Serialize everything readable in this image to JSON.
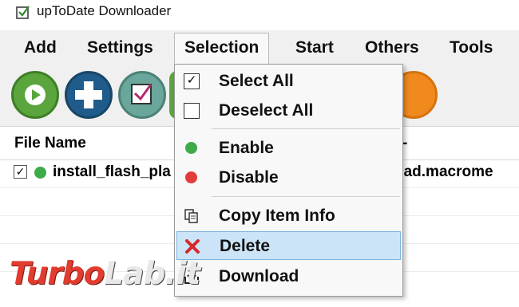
{
  "app": {
    "title": "upToDate Downloader"
  },
  "menubar": {
    "items": [
      {
        "label": "Add"
      },
      {
        "label": "Settings"
      },
      {
        "label": "Selection"
      },
      {
        "label": "Start"
      },
      {
        "label": "Others"
      },
      {
        "label": "Tools"
      }
    ],
    "open_menu": "Selection"
  },
  "toolbar": {
    "buttons": [
      {
        "icon": "play-icon",
        "color": "#5aa53c"
      },
      {
        "icon": "plus-icon",
        "color": "#1f5c8c"
      },
      {
        "icon": "checklist-icon",
        "color": "#6aa69b"
      },
      {
        "icon": "partial-button",
        "color": "#5aa53c"
      },
      {
        "icon": "orange-icon",
        "color": "#f08a1c"
      }
    ]
  },
  "list": {
    "columns": {
      "file_name": "File Name",
      "url_fragment": "-"
    },
    "rows": [
      {
        "checked": true,
        "status_color": "#3faa4a",
        "file_name": "install_flash_pla",
        "url": "oad.macrome"
      }
    ]
  },
  "selection_menu": {
    "items": [
      {
        "label": "Select All",
        "icon": "checked-box-icon"
      },
      {
        "label": "Deselect All",
        "icon": "empty-box-icon"
      },
      {
        "label": "Enable",
        "icon": "green-dot-icon",
        "color": "#3faa4a"
      },
      {
        "label": "Disable",
        "icon": "red-dot-icon",
        "color": "#e23b3b"
      },
      {
        "label": "Copy Item Info",
        "icon": "copy-icon"
      },
      {
        "label": "Delete",
        "icon": "delete-x-icon",
        "color": "#d62828",
        "highlighted": true
      },
      {
        "label": "Download",
        "icon": "download-icon"
      }
    ]
  },
  "watermark": {
    "part1": "Turbo",
    "part2": "Lab.it"
  }
}
